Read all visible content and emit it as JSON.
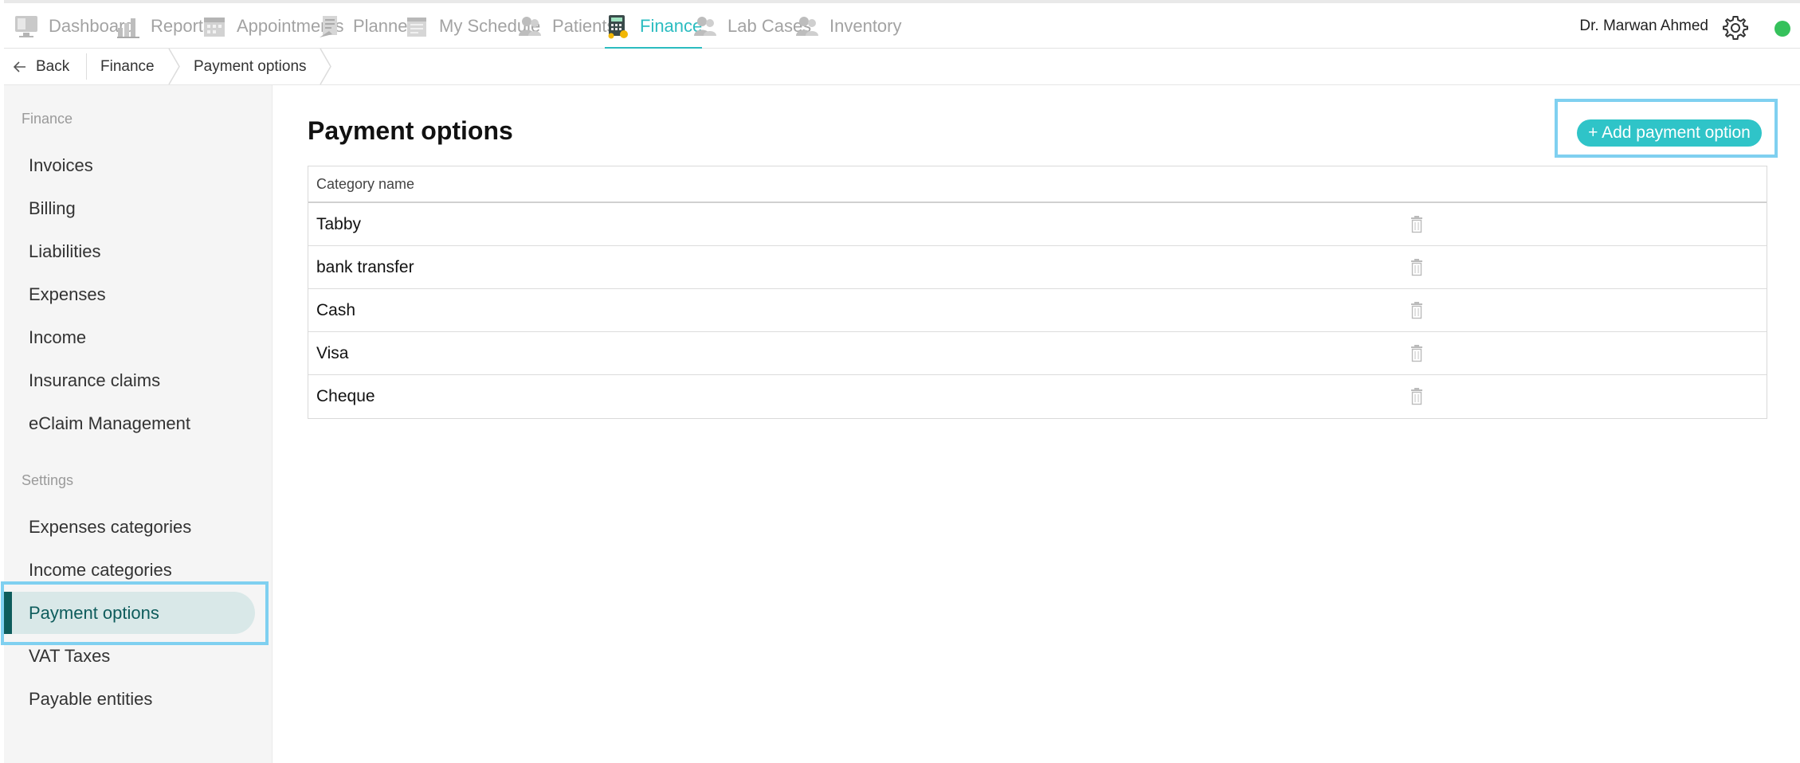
{
  "nav": {
    "items": [
      {
        "label": "Dashboard",
        "icon": "dashboard-icon"
      },
      {
        "label": "Reports",
        "icon": "reports-icon"
      },
      {
        "label": "Appointments",
        "icon": "appointments-icon"
      },
      {
        "label": "Planner",
        "icon": "planner-icon"
      },
      {
        "label": "My Schedule",
        "icon": "schedule-icon"
      },
      {
        "label": "Patients",
        "icon": "patients-icon"
      },
      {
        "label": "Finance",
        "icon": "finance-icon"
      },
      {
        "label": "Lab Cases",
        "icon": "lab-cases-icon"
      },
      {
        "label": "Inventory",
        "icon": "inventory-icon"
      }
    ],
    "active": "Finance",
    "user_name": "Dr. Marwan Ahmed",
    "accent_color": "#2bbcc0",
    "status_color": "#35c15b"
  },
  "breadcrumb": {
    "back_label": "Back",
    "items": [
      "Finance",
      "Payment options"
    ]
  },
  "sidebar": {
    "finance_heading": "Finance",
    "finance_items": [
      "Invoices",
      "Billing",
      "Liabilities",
      "Expenses",
      "Income",
      "Insurance claims",
      "eClaim Management"
    ],
    "settings_heading": "Settings",
    "settings_items": [
      "Expenses categories",
      "Income categories",
      "Payment options",
      "VAT Taxes",
      "Payable entities"
    ],
    "active_item": "Payment options"
  },
  "main": {
    "title": "Payment options",
    "add_button_label": "+ Add payment option",
    "table": {
      "column_header": "Category name",
      "rows": [
        "Tabby",
        "bank transfer",
        "Cash",
        "Visa",
        "Cheque"
      ]
    }
  }
}
